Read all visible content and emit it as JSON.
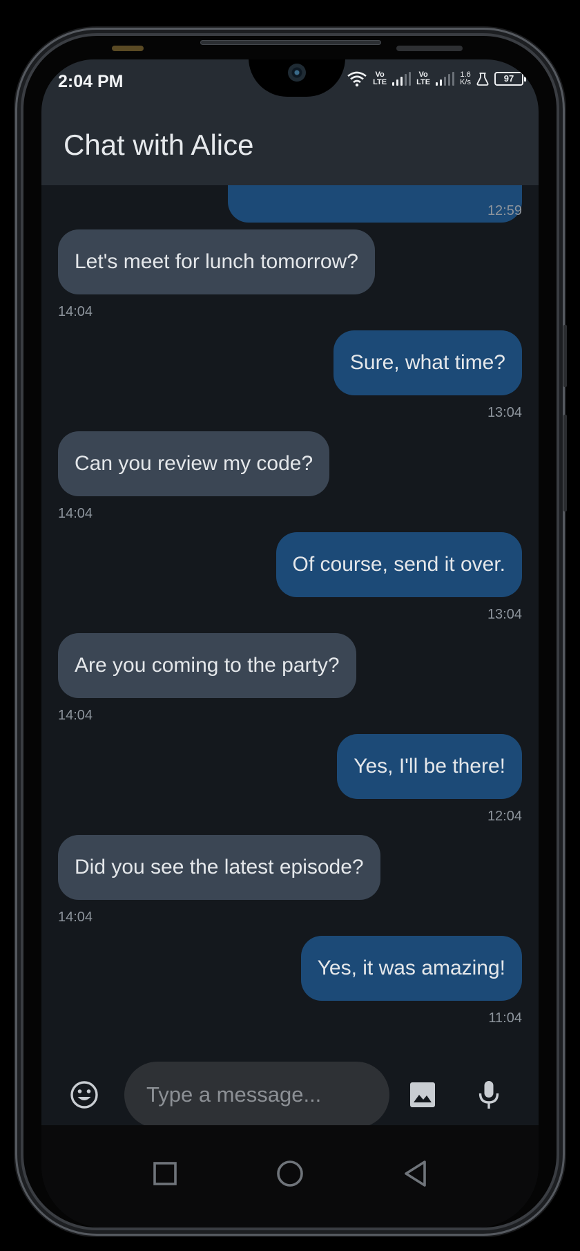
{
  "status_bar": {
    "time": "2:04 PM",
    "volte1_top": "Vo",
    "volte1_bottom": "LTE",
    "volte2_top": "Vo",
    "volte2_bottom": "LTE",
    "net_speed_value": "1.6",
    "net_speed_unit": "K/s",
    "battery": "97"
  },
  "app_bar": {
    "title": "Chat with Alice"
  },
  "messages": [
    {
      "direction": "out",
      "text": "",
      "time": "12:59",
      "partial": true
    },
    {
      "direction": "in",
      "text": "Let's meet for lunch tomorrow?",
      "time": "14:04"
    },
    {
      "direction": "out",
      "text": "Sure, what time?",
      "time": "13:04"
    },
    {
      "direction": "in",
      "text": "Can you review my code?",
      "time": "14:04"
    },
    {
      "direction": "out",
      "text": "Of course, send it over.",
      "time": "13:04"
    },
    {
      "direction": "in",
      "text": "Are you coming to the party?",
      "time": "14:04"
    },
    {
      "direction": "out",
      "text": "Yes, I'll be there!",
      "time": "12:04"
    },
    {
      "direction": "in",
      "text": "Did you see the latest episode?",
      "time": "14:04"
    },
    {
      "direction": "out",
      "text": "Yes, it was amazing!",
      "time": "11:04"
    }
  ],
  "composer": {
    "placeholder": "Type a message...",
    "value": "",
    "icons": [
      "emoji-icon",
      "image-icon",
      "microphone-icon"
    ]
  },
  "nav_bar": {
    "icons": [
      "recents-square-icon",
      "home-circle-icon",
      "back-triangle-icon"
    ]
  },
  "colors": {
    "background": "#14181d",
    "header": "#262c33",
    "incoming_bubble": "#3b4654",
    "outgoing_bubble": "#1c4a77",
    "timestamp": "#8d949c",
    "input_bg": "#2e3135"
  }
}
